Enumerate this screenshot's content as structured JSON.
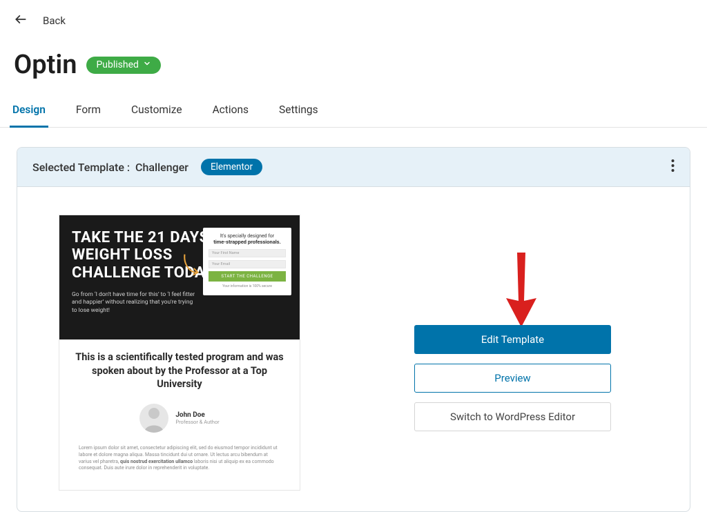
{
  "back": {
    "label": "Back"
  },
  "title": "Optin",
  "status": {
    "label": "Published"
  },
  "tabs": [
    {
      "label": "Design",
      "active": true
    },
    {
      "label": "Form"
    },
    {
      "label": "Customize"
    },
    {
      "label": "Actions"
    },
    {
      "label": "Settings"
    }
  ],
  "panel": {
    "selected_prefix": "Selected Template :",
    "template_name": "Challenger",
    "badge": "Elementor"
  },
  "preview": {
    "hero_title_l1": "TAKE THE 21 DAYS",
    "hero_title_l2": "WEIGHT LOSS",
    "hero_title_l3": "CHALLENGE TODAY",
    "hero_sub": "Go from ‘I don't have time for this’ to ‘I feel fitter and happier’ without realizing that you're trying to lose weight!",
    "form_head1": "It's specially designed for",
    "form_head2": "time-strapped professionals.",
    "form_placeholder1": "Your First Name",
    "form_placeholder2": "Your Email",
    "form_cta": "START THE CHALLENGE",
    "form_secure": "Your information is 100% secure",
    "program_title": "This is a scientifically tested program and was spoken about by the Professor at a Top University",
    "author_name": "John Doe",
    "author_role": "Professor & Author",
    "lorem_pre": "Lorem ipsum dolor sit amet, consectetur adipiscing elit, sed do eiusmod tempor incididunt ut labore et dolore magna aliqua. Massa tincidunt dui ut ornare. Ut lectus arcu bibendum at varius vel pharetra, ",
    "lorem_bold": "quis nostrud exercitation ullamco",
    "lorem_post": " laboris nisi ut aliquip ex ea commodo consequat. Duis aute irure dolor in reprehenderit in voluptate."
  },
  "actions": {
    "edit": "Edit Template",
    "preview": "Preview",
    "switch": "Switch to WordPress Editor"
  }
}
